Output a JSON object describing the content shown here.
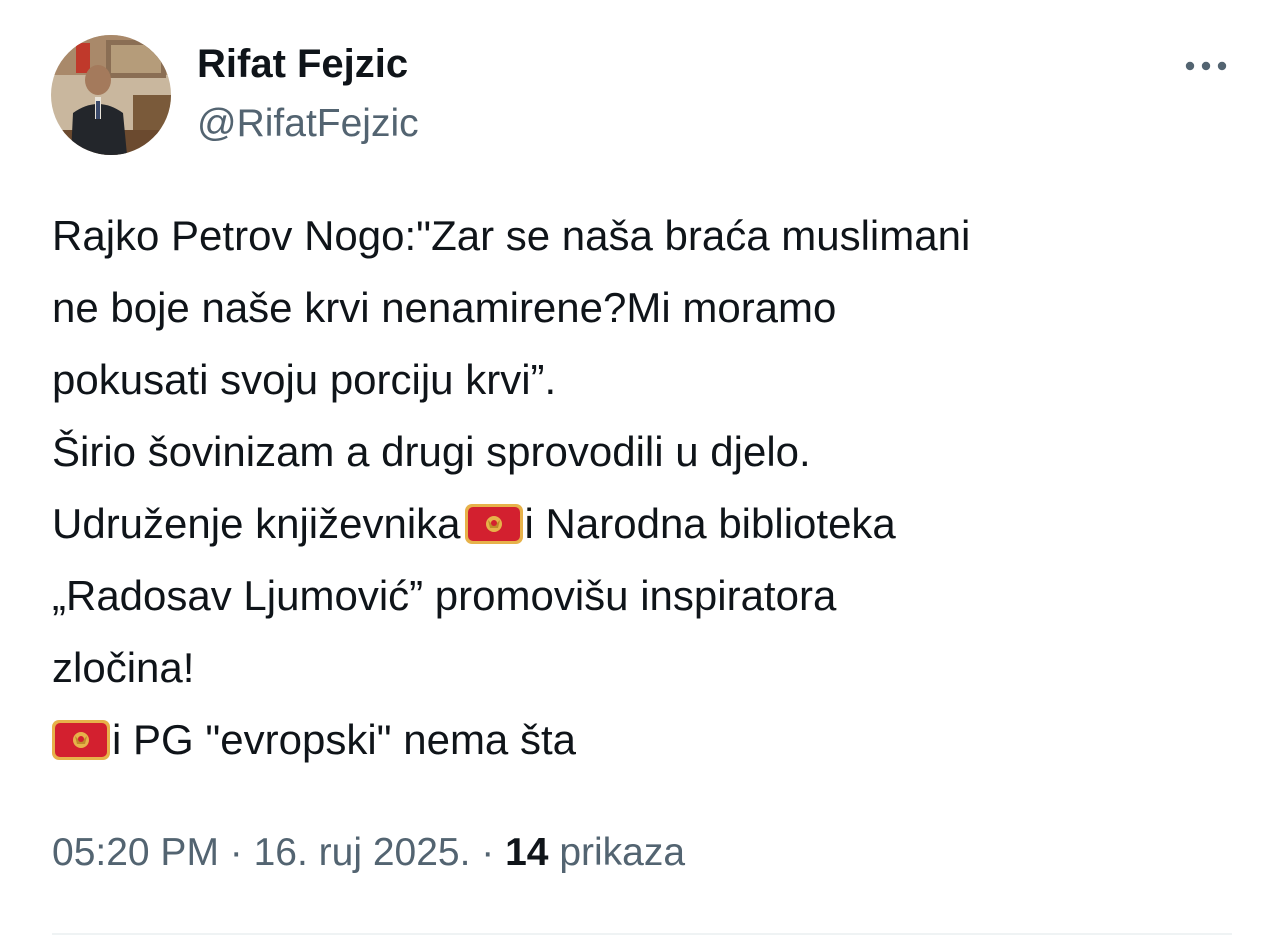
{
  "author": {
    "display_name": "Rifat Fejzic",
    "handle": "@RifatFejzic"
  },
  "tweet": {
    "lines": [
      "Rajko Petrov Nogo:\"Zar se naša braća muslimani",
      "ne boje naše krvi nenamirene?Mi moramo",
      "pokusati svoju porciju krvi”.",
      "Širio šovinizam a drugi sprovodili u djelo.",
      "Udruženje književnika",
      "i Narodna biblioteka",
      "„Radosav Ljumović” promovišu inspiratora",
      "zločina!",
      "i PG \"evropski\" nema šta"
    ],
    "flag_icon": "montenegro-flag-emoji"
  },
  "meta": {
    "time": "05:20 PM",
    "separator": " · ",
    "date": "16. ruj 2025.",
    "views_count": "14",
    "views_label": "prikaza"
  },
  "icons": {
    "more": "more-horizontal-icon"
  },
  "colors": {
    "text_primary": "#0f1419",
    "text_secondary": "#536471",
    "divider": "#eff3f4",
    "flag_red": "#d3202f",
    "flag_gold": "#e7b24a"
  }
}
